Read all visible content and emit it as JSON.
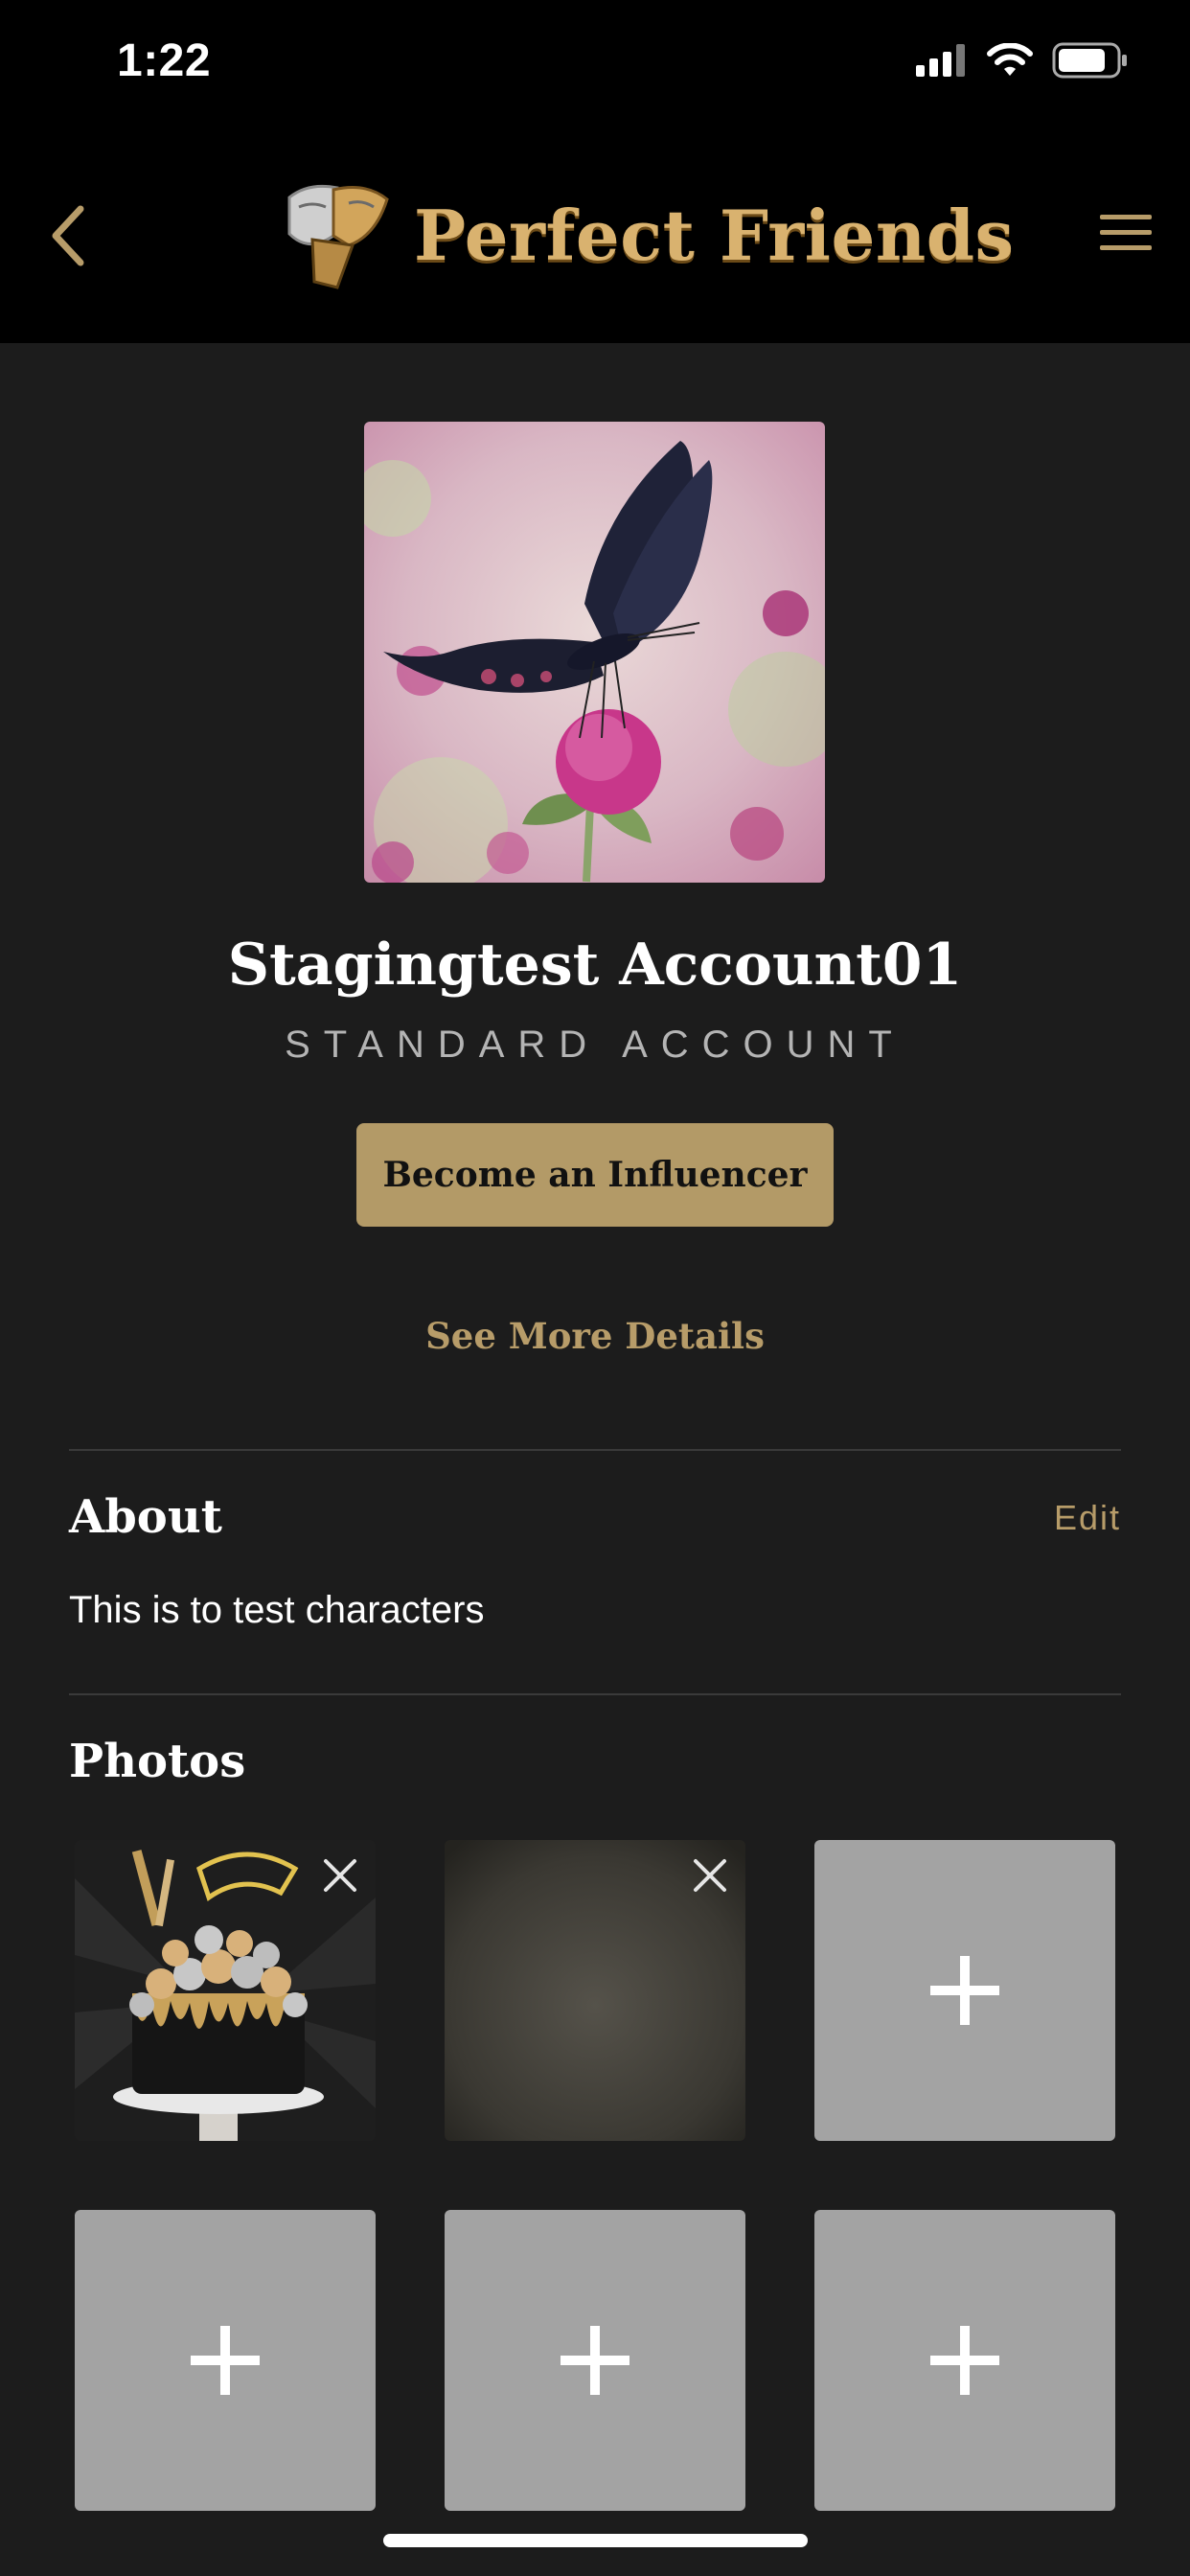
{
  "status_bar": {
    "time": "1:22"
  },
  "header": {
    "app_name": "Perfect Friends"
  },
  "profile": {
    "name": "Stagingtest Account01",
    "account_type": "STANDARD ACCOUNT",
    "influencer_button": "Become an Influencer",
    "see_more": "See More Details"
  },
  "about": {
    "title": "About",
    "edit_label": "Edit",
    "text": "This is to test characters"
  },
  "photos": {
    "title": "Photos"
  },
  "colors": {
    "accent_gold": "#b39a67",
    "background": "#1c1c1c",
    "header_background": "#000000",
    "empty_tile": "#a3a3a3"
  },
  "icons": [
    "back-chevron-icon",
    "menu-icon",
    "logo-icon",
    "signal-icon",
    "wifi-icon",
    "battery-icon",
    "plus-icon",
    "close-icon"
  ]
}
